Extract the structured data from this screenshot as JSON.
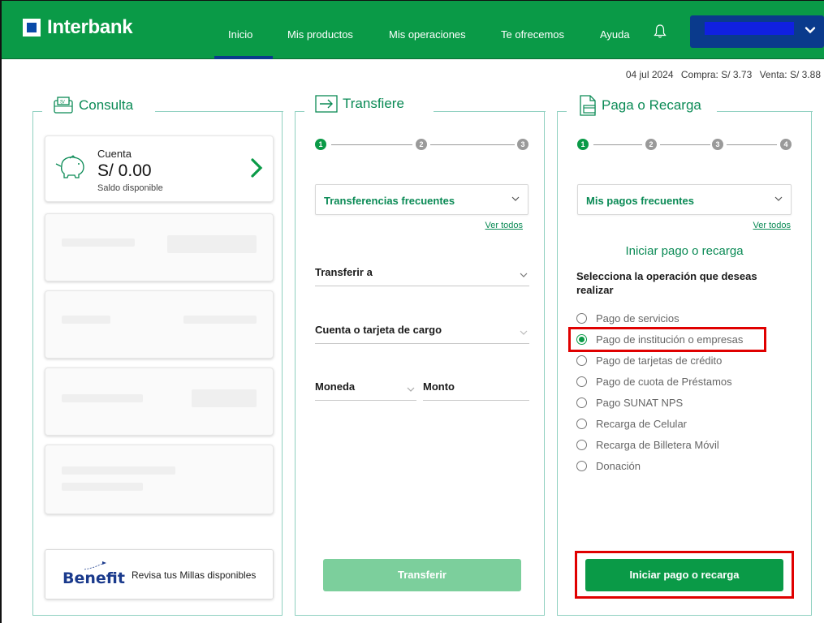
{
  "brand": {
    "name": "Interbank"
  },
  "nav": {
    "items": [
      {
        "label": "Inicio"
      },
      {
        "label": "Mis productos"
      },
      {
        "label": "Mis operaciones"
      },
      {
        "label": "Te ofrecemos"
      },
      {
        "label": "Ayuda"
      }
    ],
    "active": "Inicio"
  },
  "rates": {
    "date": "04 jul 2024",
    "buy": "Compra: S/ 3.73",
    "sell": "Venta: S/ 3.88"
  },
  "consulta": {
    "title": "Consulta",
    "account": {
      "label": "Cuenta",
      "amount": "S/ 0.00",
      "sub": "Saldo disponible"
    },
    "benefit": {
      "logo": "Benefit",
      "text": "Revisa tus Millas disponibles"
    }
  },
  "transfiere": {
    "title": "Transfiere",
    "steps": [
      "1",
      "2",
      "3"
    ],
    "frequent": "Transferencias frecuentes",
    "see_all": "Ver todos",
    "to": "Transferir a",
    "from": "Cuenta o tarjeta de cargo",
    "currency": "Moneda",
    "amount": "Monto",
    "button": "Transferir"
  },
  "paga": {
    "title": "Paga o Recarga",
    "steps": [
      "1",
      "2",
      "3",
      "4"
    ],
    "frequent": "Mis pagos frecuentes",
    "see_all": "Ver todos",
    "heading": "Iniciar pago o recarga",
    "instruction": "Selecciona la operación que deseas realizar",
    "options": [
      {
        "label": "Pago de servicios",
        "selected": false
      },
      {
        "label": "Pago de institución o empresas",
        "selected": true
      },
      {
        "label": "Pago de tarjetas de crédito",
        "selected": false
      },
      {
        "label": "Pago de cuota de Préstamos",
        "selected": false
      },
      {
        "label": "Pago SUNAT NPS",
        "selected": false
      },
      {
        "label": "Recarga de Celular",
        "selected": false
      },
      {
        "label": "Recarga de Billetera Móvil",
        "selected": false
      },
      {
        "label": "Donación",
        "selected": false
      }
    ],
    "button": "Iniciar pago o recarga"
  },
  "colors": {
    "brand_green": "#0a9a47",
    "brand_blue": "#0a3a8c",
    "highlight_red": "#e00000",
    "teal_border": "#8fd0c0"
  },
  "icons": [
    "interbank-logo-icon",
    "bell-icon",
    "chevron-down-icon",
    "money-card-icon",
    "transfer-arrow-icon",
    "document-card-icon",
    "piggy-bank-icon",
    "chevron-right-icon",
    "airplane-icon"
  ]
}
